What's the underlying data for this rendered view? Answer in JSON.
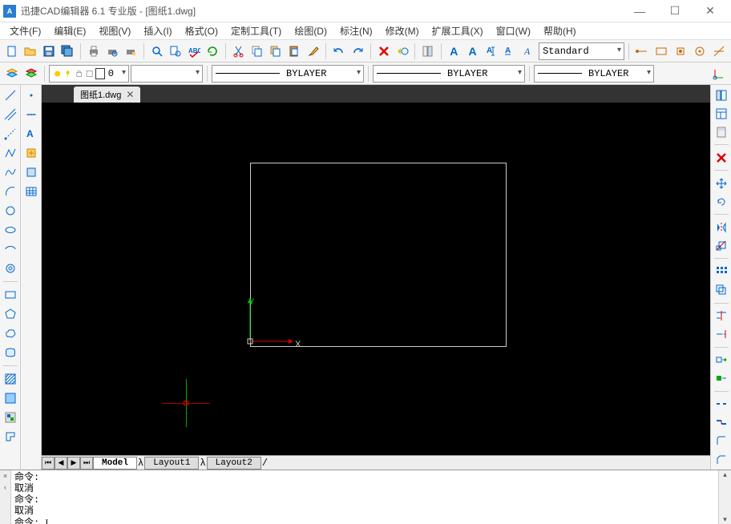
{
  "titlebar": {
    "app_icon_text": "A",
    "title": "迅捷CAD编辑器 6.1 专业版  -  [图纸1.dwg]",
    "min": "—",
    "max": "☐",
    "close": "✕"
  },
  "menu": {
    "items": [
      "文件(F)",
      "编辑(E)",
      "视图(V)",
      "插入(I)",
      "格式(O)",
      "定制工具(T)",
      "绘图(D)",
      "标注(N)",
      "修改(M)",
      "扩展工具(X)",
      "窗口(W)",
      "帮助(H)"
    ]
  },
  "toolbar1": {
    "style_select": "Standard"
  },
  "toolbar2": {
    "layer_value": "0",
    "linetype_label": "BYLAYER",
    "lineweight_label": "BYLAYER",
    "plotstyle_label": "BYLAYER"
  },
  "doc_tab": {
    "name": "图纸1.dwg",
    "close": "✕"
  },
  "ucs": {
    "x": "X",
    "y": "Y"
  },
  "layout_tabs": {
    "nav": [
      "⏮",
      "◀",
      "▶",
      "⏭"
    ],
    "model": "Model",
    "layout1": "Layout1",
    "layout2": "Layout2"
  },
  "command": {
    "lines": [
      "命令:",
      "取消",
      "命令:",
      "取消",
      "命令:"
    ],
    "cursor": "I",
    "toggle_up": "×",
    "toggle_down": "‹",
    "scroll_up": "▴",
    "scroll_down": "▾"
  },
  "colors": {
    "red": "#d00",
    "green": "#0a0",
    "blue": "#06c",
    "yellow": "#cc0",
    "cyan": "#0cc"
  }
}
